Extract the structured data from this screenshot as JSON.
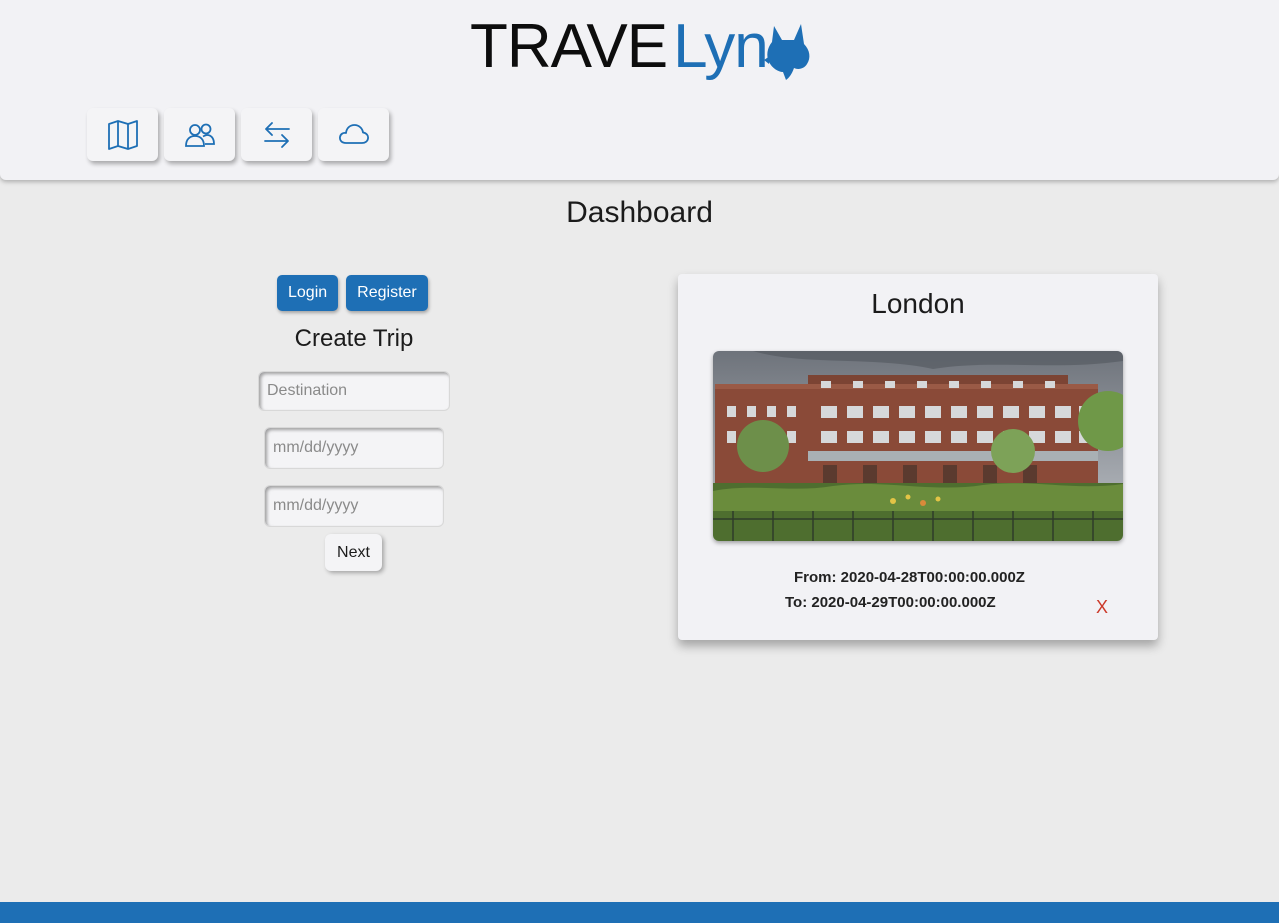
{
  "header": {
    "logo_left": "TRAVE",
    "logo_right": "Lyn",
    "nav": [
      {
        "icon": "map-icon"
      },
      {
        "icon": "users-icon"
      },
      {
        "icon": "swap-arrows-icon"
      },
      {
        "icon": "cloud-icon"
      }
    ]
  },
  "page": {
    "title": "Dashboard"
  },
  "auth": {
    "login_label": "Login",
    "register_label": "Register"
  },
  "create_trip": {
    "title": "Create Trip",
    "destination_placeholder": "Destination",
    "start_date_placeholder": "mm/dd/yyyy",
    "end_date_placeholder": "mm/dd/yyyy",
    "next_label": "Next"
  },
  "trip": {
    "city": "London",
    "from_text": "From: 2020-04-28T00:00:00.000Z",
    "to_text": "To: 2020-04-29T00:00:00.000Z",
    "delete_label": "X"
  },
  "colors": {
    "accent": "#1e6fb5",
    "delete": "#cc3a2a"
  }
}
